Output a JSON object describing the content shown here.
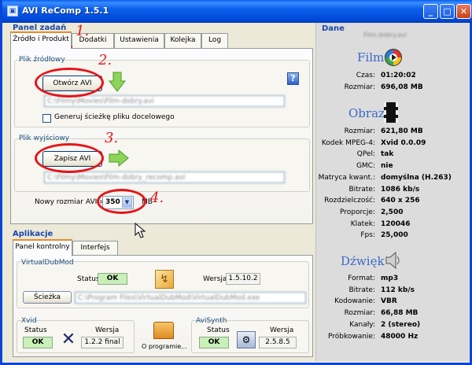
{
  "window": {
    "title": "AVI ReComp  1.5.1"
  },
  "left": {
    "panel_title": "Panel zadań",
    "tabs": [
      "Źródło i Produkt",
      "Dodatki",
      "Ustawienia",
      "Kolejka",
      "Log"
    ],
    "source": {
      "group_label": "Plik źródłowy",
      "open_button": "Otwórz AVI",
      "path": "C:\\Filmy\\Movies\\Film-dobry.avi",
      "checkbox_label": "Generuj ścieżkę pliku docelowego"
    },
    "output": {
      "group_label": "Plik wyjściowy",
      "save_button": "Zapisz AVI",
      "path": "C:\\Filmy\\Movies\\Film-dobry_recomp.avi",
      "size_label": "Nowy rozmiar AVI =",
      "size_value": "350",
      "size_unit": "MB"
    },
    "annotations": [
      "1.",
      "2.",
      "3.",
      "4."
    ],
    "apps": {
      "title": "Aplikacje",
      "tabs": [
        "Panel kontrolny",
        "Interfejs"
      ],
      "vdm": {
        "label": "VirtualDubMod",
        "status_label": "Status",
        "status": "OK",
        "version_label": "Wersja",
        "version": "1.5.10.2",
        "path_button": "Ścieżka",
        "path": "C:\\Program Files\\VirtualDubMod\\VirtualDubMod.exe"
      },
      "xvid": {
        "label": "Xvid",
        "status_label": "Status",
        "status": "OK",
        "version_label": "Wersja",
        "version": "1.2.2 final"
      },
      "about": "O programie...",
      "avisynth": {
        "label": "AviSynth",
        "status_label": "Status",
        "status": "OK",
        "version_label": "Wersja",
        "version": "2.5.8.5"
      }
    }
  },
  "right": {
    "title": "Dane",
    "filename": "Film.dobry.avi",
    "film": {
      "heading": "Film",
      "rows": [
        {
          "k": "Czas:",
          "v": "01:20:02"
        },
        {
          "k": "Rozmiar:",
          "v": "696,08 MB"
        }
      ]
    },
    "obraz": {
      "heading": "Obraz",
      "rows": [
        {
          "k": "Rozmiar:",
          "v": "621,80 MB"
        },
        {
          "k": "Kodek MPEG-4:",
          "v": "Xvid 0.0.09"
        },
        {
          "k": "QPel:",
          "v": "tak"
        },
        {
          "k": "GMC:",
          "v": "nie"
        },
        {
          "k": "Matryca kwant.:",
          "v": "domyślna (H.263)"
        },
        {
          "k": "Bitrate:",
          "v": "1086 kb/s"
        },
        {
          "k": "Rozdzielczość:",
          "v": "640 x 256"
        },
        {
          "k": "Proporcje:",
          "v": "2,500"
        },
        {
          "k": "Klatek:",
          "v": "120046"
        },
        {
          "k": "Fps:",
          "v": "25,000"
        }
      ]
    },
    "dzwiek": {
      "heading": "Dźwięk",
      "rows": [
        {
          "k": "Format:",
          "v": "mp3"
        },
        {
          "k": "Bitrate:",
          "v": "112 kb/s"
        },
        {
          "k": "Kodowanie:",
          "v": "VBR"
        },
        {
          "k": "Rozmiar:",
          "v": "66,88 MB"
        },
        {
          "k": "Kanały:",
          "v": "2 (stereo)"
        },
        {
          "k": "Próbkowanie:",
          "v": "48000 Hz"
        }
      ]
    }
  }
}
